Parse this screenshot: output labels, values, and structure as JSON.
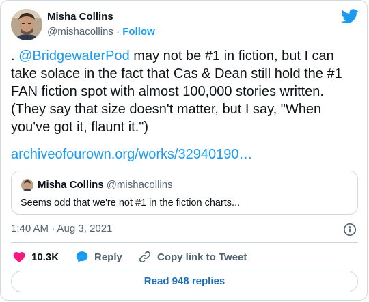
{
  "author": {
    "name": "Misha Collins",
    "handle": "@mishacollins",
    "separator": "·",
    "follow_label": "Follow",
    "avatar_icon": "avatar-photo"
  },
  "brand": {
    "icon": "twitter-bird-icon",
    "color": "#1d9bf0"
  },
  "tweet": {
    "prefix": ". ",
    "mention": "@BridgewaterPod",
    "body_after_mention": " may not be #1 in fiction, but I can take solace in the fact that Cas & Dean still hold the #1 FAN fiction spot with almost 100,000 stories written. (They say that size doesn't matter, but I say, \"When you've got it, flaunt it.\")",
    "link": "archiveofourown.org/works/32940190…"
  },
  "quoted_tweet": {
    "name": "Misha Collins",
    "handle": "@mishacollins",
    "text": "Seems odd that we're not #1 in the fiction charts..."
  },
  "meta": {
    "timestamp": "1:40 AM · Aug 3, 2021",
    "info_icon": "info-icon"
  },
  "actions": {
    "like_count": "10.3K",
    "like_icon": "heart-icon",
    "like_color": "#f91880",
    "reply_label": "Reply",
    "reply_icon": "reply-bubble-icon",
    "copy_link_label": "Copy link to Tweet",
    "copy_link_icon": "link-icon"
  },
  "footer": {
    "read_replies_label": "Read 948 replies"
  }
}
